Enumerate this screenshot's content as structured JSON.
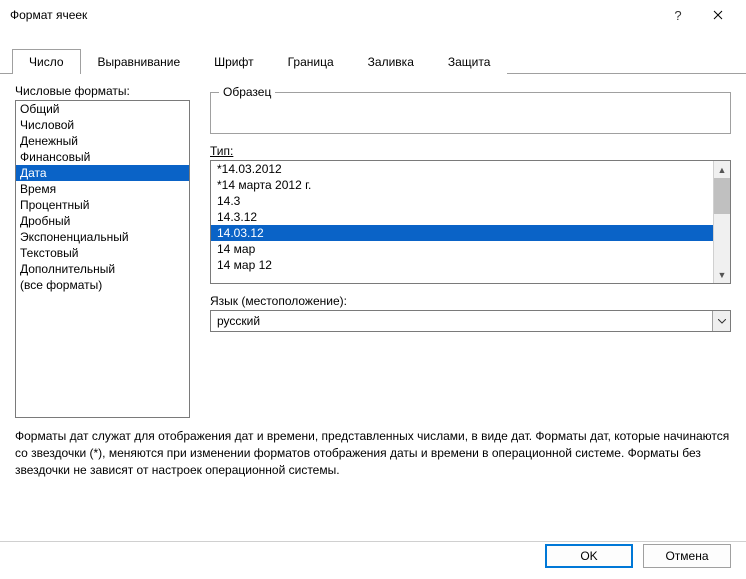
{
  "dialog": {
    "title": "Формат ячеек"
  },
  "tabs": {
    "items": [
      {
        "label": "Число"
      },
      {
        "label": "Выравнивание"
      },
      {
        "label": "Шрифт"
      },
      {
        "label": "Граница"
      },
      {
        "label": "Заливка"
      },
      {
        "label": "Защита"
      }
    ],
    "active": 0
  },
  "left": {
    "label": "Числовые форматы:",
    "items": [
      "Общий",
      "Числовой",
      "Денежный",
      "Финансовый",
      "Дата",
      "Время",
      "Процентный",
      "Дробный",
      "Экспоненциальный",
      "Текстовый",
      "Дополнительный",
      "(все форматы)"
    ],
    "selected": 4
  },
  "sample": {
    "legend": "Образец",
    "value": ""
  },
  "type": {
    "label": "Тип:",
    "items": [
      "*14.03.2012",
      "*14 марта 2012 г.",
      "14.3",
      "14.3.12",
      "14.03.12",
      "14 мар",
      "14 мар 12"
    ],
    "selected": 4
  },
  "locale": {
    "label": "Язык (местоположение):",
    "value": "русский"
  },
  "description": "Форматы дат служат для отображения дат и времени, представленных числами, в виде дат. Форматы дат, которые начинаются со звездочки (*), меняются при изменении форматов отображения даты и времени в операционной системе. Форматы без звездочки не зависят от настроек операционной системы.",
  "buttons": {
    "ok": "OK",
    "cancel": "Отмена"
  }
}
